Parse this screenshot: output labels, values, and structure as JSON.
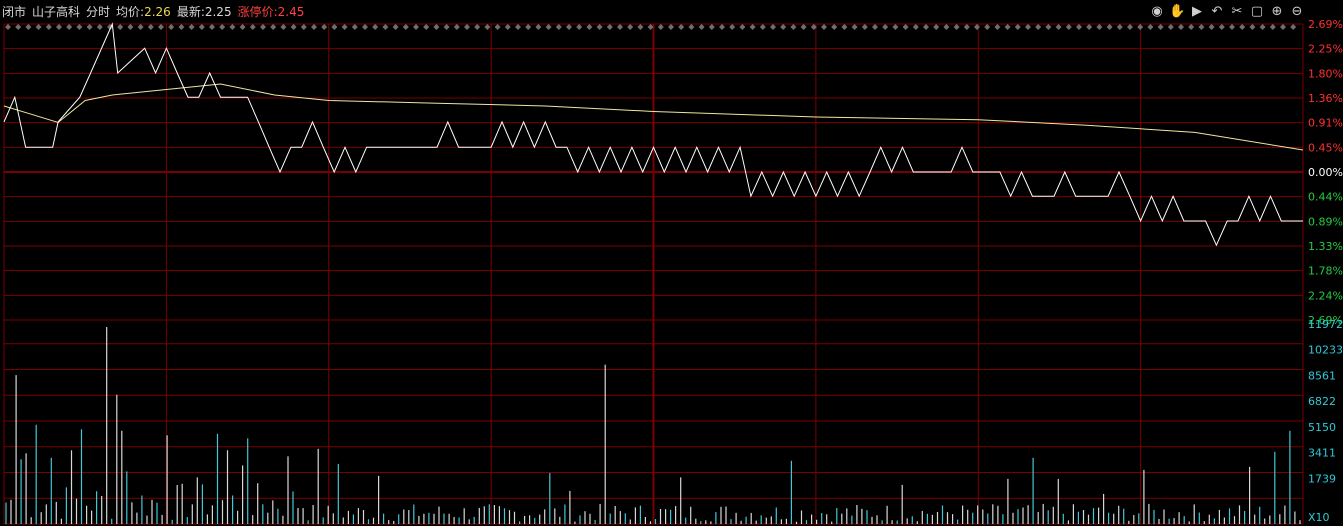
{
  "header": {
    "status": "闭市",
    "stock_name": "山子高科",
    "mode": "分时",
    "avg_label": "均价:",
    "avg_value": "2.26",
    "latest_label": "最新:",
    "latest_value": "2.25",
    "limit_label": "涨停价:",
    "limit_value": "2.45"
  },
  "toolbar": {
    "icons": [
      "eye-icon",
      "hand-icon",
      "play-icon",
      "undo-icon",
      "scissors-icon",
      "lock-icon",
      "zoom-in-icon",
      "zoom-out-icon"
    ]
  },
  "colors": {
    "grid": "#7a0000",
    "price_line": "#ffffff",
    "avg_line": "#f0e6a0",
    "up": "#ff3030",
    "down": "#22cc44",
    "volume_axis": "#30c8d8",
    "volume_bar_light": "#d8d8d8",
    "volume_bar_cyan": "#40c8d8"
  },
  "chart_data": {
    "type": "line",
    "prev_close": 2.26,
    "price_axis_labels_up": [
      "2.69%",
      "2.25%",
      "1.80%",
      "1.36%",
      "0.91%",
      "0.45%"
    ],
    "price_axis_label_zero": "0.00%",
    "price_axis_labels_down": [
      "0.44%",
      "0.89%",
      "1.33%",
      "1.78%",
      "2.24%",
      "2.69%"
    ],
    "price_ylim_pct": [
      -2.69,
      2.69
    ],
    "volume_axis_labels": [
      "11972",
      "10233",
      "8561",
      "6822",
      "5150",
      "3411",
      "1739",
      "X10"
    ],
    "volume_ylim": [
      0,
      13700
    ],
    "minutes": 240,
    "price_pct_keypoints": [
      [
        0,
        0.91
      ],
      [
        2,
        1.36
      ],
      [
        4,
        0.45
      ],
      [
        9,
        0.45
      ],
      [
        10,
        0.91
      ],
      [
        14,
        1.36
      ],
      [
        16,
        1.8
      ],
      [
        20,
        2.69
      ],
      [
        21,
        1.8
      ],
      [
        26,
        2.25
      ],
      [
        28,
        1.8
      ],
      [
        30,
        2.25
      ],
      [
        32,
        1.8
      ],
      [
        34,
        1.36
      ],
      [
        36,
        1.36
      ],
      [
        38,
        1.8
      ],
      [
        40,
        1.36
      ],
      [
        45,
        1.36
      ],
      [
        47,
        0.91
      ],
      [
        49,
        0.45
      ],
      [
        51,
        0.0
      ],
      [
        53,
        0.45
      ],
      [
        55,
        0.45
      ],
      [
        57,
        0.91
      ],
      [
        59,
        0.45
      ],
      [
        61,
        0.0
      ],
      [
        63,
        0.45
      ],
      [
        65,
        0.0
      ],
      [
        67,
        0.45
      ],
      [
        80,
        0.45
      ],
      [
        82,
        0.91
      ],
      [
        84,
        0.45
      ],
      [
        90,
        0.45
      ],
      [
        92,
        0.91
      ],
      [
        94,
        0.45
      ],
      [
        96,
        0.91
      ],
      [
        98,
        0.45
      ],
      [
        100,
        0.91
      ],
      [
        102,
        0.45
      ],
      [
        104,
        0.45
      ],
      [
        106,
        0.0
      ],
      [
        108,
        0.45
      ],
      [
        110,
        0.0
      ],
      [
        112,
        0.45
      ],
      [
        114,
        0.0
      ],
      [
        116,
        0.45
      ],
      [
        118,
        0.0
      ],
      [
        120,
        0.45
      ],
      [
        122,
        0.0
      ],
      [
        124,
        0.45
      ],
      [
        126,
        0.0
      ],
      [
        128,
        0.45
      ],
      [
        130,
        0.0
      ],
      [
        132,
        0.45
      ],
      [
        134,
        0.0
      ],
      [
        136,
        0.45
      ],
      [
        138,
        -0.44
      ],
      [
        140,
        0.0
      ],
      [
        142,
        -0.44
      ],
      [
        144,
        0.0
      ],
      [
        146,
        -0.44
      ],
      [
        148,
        0.0
      ],
      [
        150,
        -0.44
      ],
      [
        152,
        0.0
      ],
      [
        154,
        -0.44
      ],
      [
        156,
        0.0
      ],
      [
        158,
        -0.44
      ],
      [
        160,
        0.0
      ],
      [
        162,
        0.45
      ],
      [
        164,
        0.0
      ],
      [
        166,
        0.45
      ],
      [
        168,
        0.0
      ],
      [
        175,
        0.0
      ],
      [
        177,
        0.45
      ],
      [
        179,
        0.0
      ],
      [
        184,
        0.0
      ],
      [
        186,
        -0.44
      ],
      [
        188,
        0.0
      ],
      [
        190,
        -0.44
      ],
      [
        194,
        -0.44
      ],
      [
        196,
        0.0
      ],
      [
        198,
        -0.44
      ],
      [
        204,
        -0.44
      ],
      [
        206,
        0.0
      ],
      [
        208,
        -0.44
      ],
      [
        210,
        -0.89
      ],
      [
        212,
        -0.44
      ],
      [
        214,
        -0.89
      ],
      [
        216,
        -0.44
      ],
      [
        218,
        -0.89
      ],
      [
        222,
        -0.89
      ],
      [
        224,
        -1.33
      ],
      [
        226,
        -0.89
      ],
      [
        228,
        -0.89
      ],
      [
        230,
        -0.44
      ],
      [
        232,
        -0.89
      ],
      [
        234,
        -0.44
      ],
      [
        236,
        -0.89
      ],
      [
        240,
        -0.89
      ]
    ],
    "avg_pct_keypoints": [
      [
        0,
        1.2
      ],
      [
        5,
        1.05
      ],
      [
        10,
        0.9
      ],
      [
        15,
        1.3
      ],
      [
        20,
        1.4
      ],
      [
        30,
        1.5
      ],
      [
        40,
        1.6
      ],
      [
        50,
        1.4
      ],
      [
        60,
        1.3
      ],
      [
        80,
        1.25
      ],
      [
        100,
        1.2
      ],
      [
        120,
        1.1
      ],
      [
        150,
        1.0
      ],
      [
        180,
        0.95
      ],
      [
        200,
        0.85
      ],
      [
        220,
        0.72
      ],
      [
        240,
        0.4
      ]
    ],
    "volume_peaks": [
      [
        2,
        9900
      ],
      [
        3,
        4300
      ],
      [
        4,
        4700
      ],
      [
        6,
        6600
      ],
      [
        9,
        4400
      ],
      [
        13,
        4900
      ],
      [
        15,
        6300
      ],
      [
        20,
        13100
      ],
      [
        22,
        8600
      ],
      [
        23,
        6200
      ],
      [
        24,
        3500
      ],
      [
        32,
        5900
      ],
      [
        38,
        3100
      ],
      [
        42,
        6000
      ],
      [
        44,
        4900
      ],
      [
        47,
        3900
      ],
      [
        48,
        5700
      ],
      [
        56,
        4500
      ],
      [
        62,
        5000
      ],
      [
        66,
        4000
      ],
      [
        74,
        3200
      ],
      [
        108,
        3400
      ],
      [
        112,
        2200
      ],
      [
        119,
        10600
      ],
      [
        134,
        3100
      ],
      [
        156,
        4200
      ],
      [
        178,
        2600
      ],
      [
        199,
        3000
      ],
      [
        204,
        4400
      ],
      [
        209,
        3000
      ],
      [
        218,
        2000
      ],
      [
        226,
        3600
      ],
      [
        247,
        3800
      ],
      [
        252,
        4800
      ],
      [
        255,
        6200
      ]
    ]
  }
}
